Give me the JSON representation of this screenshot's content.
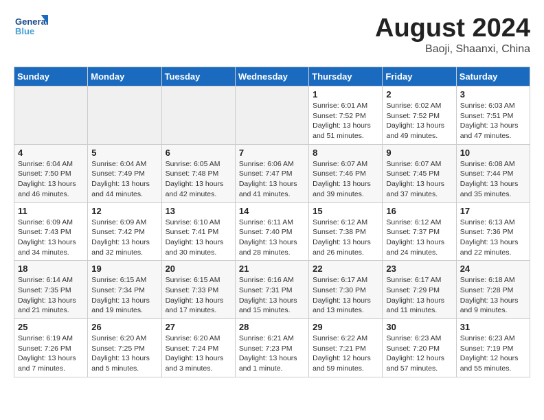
{
  "header": {
    "logo_line1": "General",
    "logo_line2": "Blue",
    "month_title": "August 2024",
    "location": "Baoji, Shaanxi, China"
  },
  "weekdays": [
    "Sunday",
    "Monday",
    "Tuesday",
    "Wednesday",
    "Thursday",
    "Friday",
    "Saturday"
  ],
  "weeks": [
    [
      {
        "day": "",
        "info": ""
      },
      {
        "day": "",
        "info": ""
      },
      {
        "day": "",
        "info": ""
      },
      {
        "day": "",
        "info": ""
      },
      {
        "day": "1",
        "info": "Sunrise: 6:01 AM\nSunset: 7:52 PM\nDaylight: 13 hours\nand 51 minutes."
      },
      {
        "day": "2",
        "info": "Sunrise: 6:02 AM\nSunset: 7:52 PM\nDaylight: 13 hours\nand 49 minutes."
      },
      {
        "day": "3",
        "info": "Sunrise: 6:03 AM\nSunset: 7:51 PM\nDaylight: 13 hours\nand 47 minutes."
      }
    ],
    [
      {
        "day": "4",
        "info": "Sunrise: 6:04 AM\nSunset: 7:50 PM\nDaylight: 13 hours\nand 46 minutes."
      },
      {
        "day": "5",
        "info": "Sunrise: 6:04 AM\nSunset: 7:49 PM\nDaylight: 13 hours\nand 44 minutes."
      },
      {
        "day": "6",
        "info": "Sunrise: 6:05 AM\nSunset: 7:48 PM\nDaylight: 13 hours\nand 42 minutes."
      },
      {
        "day": "7",
        "info": "Sunrise: 6:06 AM\nSunset: 7:47 PM\nDaylight: 13 hours\nand 41 minutes."
      },
      {
        "day": "8",
        "info": "Sunrise: 6:07 AM\nSunset: 7:46 PM\nDaylight: 13 hours\nand 39 minutes."
      },
      {
        "day": "9",
        "info": "Sunrise: 6:07 AM\nSunset: 7:45 PM\nDaylight: 13 hours\nand 37 minutes."
      },
      {
        "day": "10",
        "info": "Sunrise: 6:08 AM\nSunset: 7:44 PM\nDaylight: 13 hours\nand 35 minutes."
      }
    ],
    [
      {
        "day": "11",
        "info": "Sunrise: 6:09 AM\nSunset: 7:43 PM\nDaylight: 13 hours\nand 34 minutes."
      },
      {
        "day": "12",
        "info": "Sunrise: 6:09 AM\nSunset: 7:42 PM\nDaylight: 13 hours\nand 32 minutes."
      },
      {
        "day": "13",
        "info": "Sunrise: 6:10 AM\nSunset: 7:41 PM\nDaylight: 13 hours\nand 30 minutes."
      },
      {
        "day": "14",
        "info": "Sunrise: 6:11 AM\nSunset: 7:40 PM\nDaylight: 13 hours\nand 28 minutes."
      },
      {
        "day": "15",
        "info": "Sunrise: 6:12 AM\nSunset: 7:38 PM\nDaylight: 13 hours\nand 26 minutes."
      },
      {
        "day": "16",
        "info": "Sunrise: 6:12 AM\nSunset: 7:37 PM\nDaylight: 13 hours\nand 24 minutes."
      },
      {
        "day": "17",
        "info": "Sunrise: 6:13 AM\nSunset: 7:36 PM\nDaylight: 13 hours\nand 22 minutes."
      }
    ],
    [
      {
        "day": "18",
        "info": "Sunrise: 6:14 AM\nSunset: 7:35 PM\nDaylight: 13 hours\nand 21 minutes."
      },
      {
        "day": "19",
        "info": "Sunrise: 6:15 AM\nSunset: 7:34 PM\nDaylight: 13 hours\nand 19 minutes."
      },
      {
        "day": "20",
        "info": "Sunrise: 6:15 AM\nSunset: 7:33 PM\nDaylight: 13 hours\nand 17 minutes."
      },
      {
        "day": "21",
        "info": "Sunrise: 6:16 AM\nSunset: 7:31 PM\nDaylight: 13 hours\nand 15 minutes."
      },
      {
        "day": "22",
        "info": "Sunrise: 6:17 AM\nSunset: 7:30 PM\nDaylight: 13 hours\nand 13 minutes."
      },
      {
        "day": "23",
        "info": "Sunrise: 6:17 AM\nSunset: 7:29 PM\nDaylight: 13 hours\nand 11 minutes."
      },
      {
        "day": "24",
        "info": "Sunrise: 6:18 AM\nSunset: 7:28 PM\nDaylight: 13 hours\nand 9 minutes."
      }
    ],
    [
      {
        "day": "25",
        "info": "Sunrise: 6:19 AM\nSunset: 7:26 PM\nDaylight: 13 hours\nand 7 minutes."
      },
      {
        "day": "26",
        "info": "Sunrise: 6:20 AM\nSunset: 7:25 PM\nDaylight: 13 hours\nand 5 minutes."
      },
      {
        "day": "27",
        "info": "Sunrise: 6:20 AM\nSunset: 7:24 PM\nDaylight: 13 hours\nand 3 minutes."
      },
      {
        "day": "28",
        "info": "Sunrise: 6:21 AM\nSunset: 7:23 PM\nDaylight: 13 hours\nand 1 minute."
      },
      {
        "day": "29",
        "info": "Sunrise: 6:22 AM\nSunset: 7:21 PM\nDaylight: 12 hours\nand 59 minutes."
      },
      {
        "day": "30",
        "info": "Sunrise: 6:23 AM\nSunset: 7:20 PM\nDaylight: 12 hours\nand 57 minutes."
      },
      {
        "day": "31",
        "info": "Sunrise: 6:23 AM\nSunset: 7:19 PM\nDaylight: 12 hours\nand 55 minutes."
      }
    ]
  ]
}
